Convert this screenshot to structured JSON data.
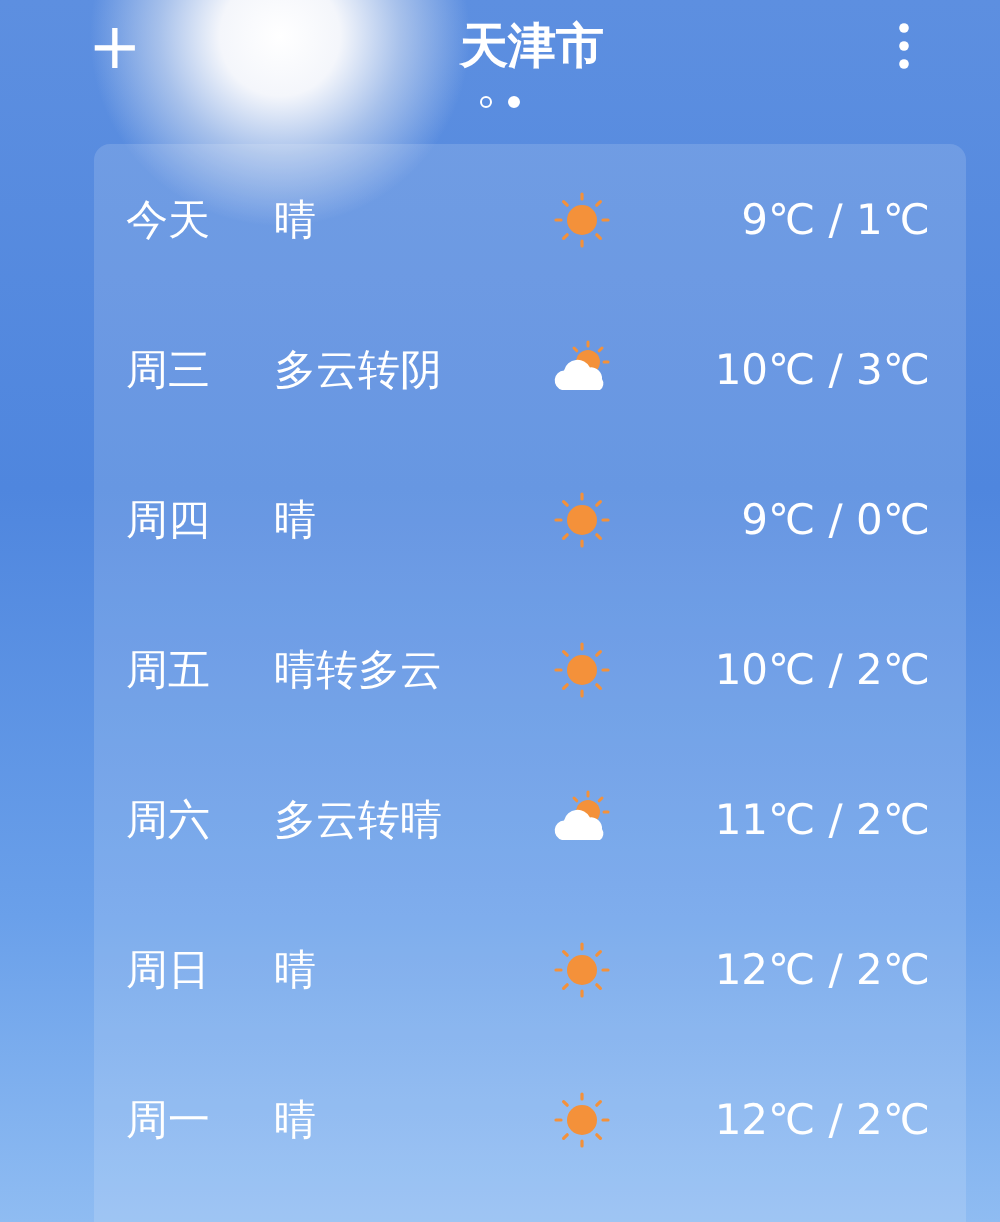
{
  "header": {
    "add_button": "+",
    "title": "天津市"
  },
  "pages": [
    {
      "selected": false
    },
    {
      "selected": true
    }
  ],
  "forecast": [
    {
      "day": "今天",
      "condition": "晴",
      "kind": "sunny",
      "temperature": "9℃ / 1℃"
    },
    {
      "day": "周三",
      "condition": "多云转阴",
      "kind": "partly_cloudy",
      "temperature": "10℃ / 3℃"
    },
    {
      "day": "周四",
      "condition": "晴",
      "kind": "sunny",
      "temperature": "9℃ / 0℃"
    },
    {
      "day": "周五",
      "condition": "晴转多云",
      "kind": "sunny",
      "temperature": "10℃ / 2℃"
    },
    {
      "day": "周六",
      "condition": "多云转晴",
      "kind": "partly_cloudy",
      "temperature": "11℃ / 2℃"
    },
    {
      "day": "周日",
      "condition": "晴",
      "kind": "sunny",
      "temperature": "12℃ / 2℃"
    },
    {
      "day": "周一",
      "condition": "晴",
      "kind": "sunny",
      "temperature": "12℃ / 2℃"
    }
  ]
}
